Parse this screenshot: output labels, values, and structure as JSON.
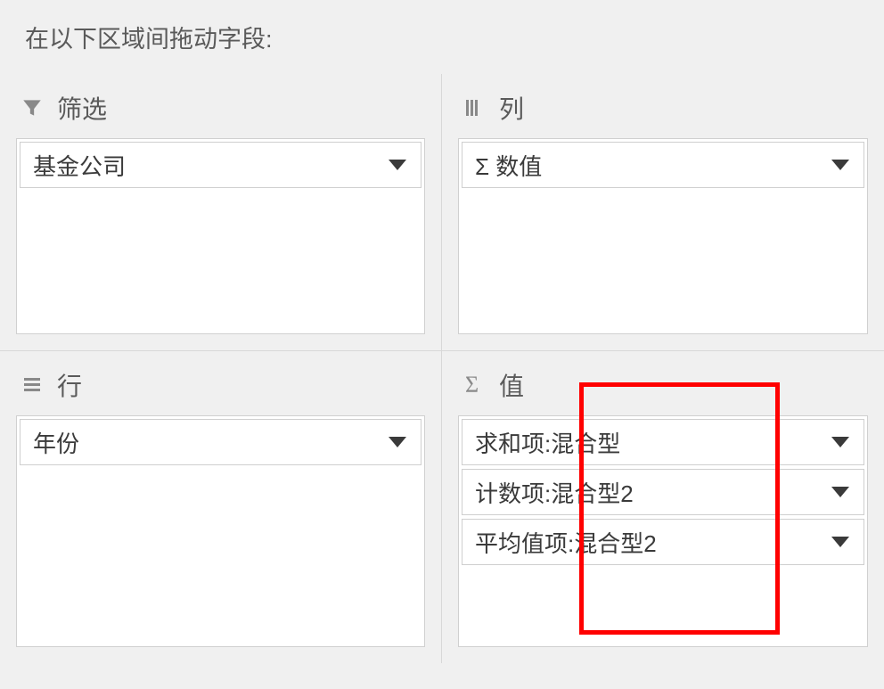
{
  "instruction": "在以下区域间拖动字段:",
  "areas": {
    "filters": {
      "label": "筛选",
      "items": [
        {
          "label": "基金公司"
        }
      ]
    },
    "columns": {
      "label": "列",
      "items": [
        {
          "label": "Σ 数值"
        }
      ]
    },
    "rows": {
      "label": "行",
      "items": [
        {
          "label": "年份"
        }
      ]
    },
    "values": {
      "label": "值",
      "items": [
        {
          "label": "求和项:混合型"
        },
        {
          "label": "计数项:混合型2"
        },
        {
          "label": "平均值项:混合型2"
        }
      ]
    }
  }
}
